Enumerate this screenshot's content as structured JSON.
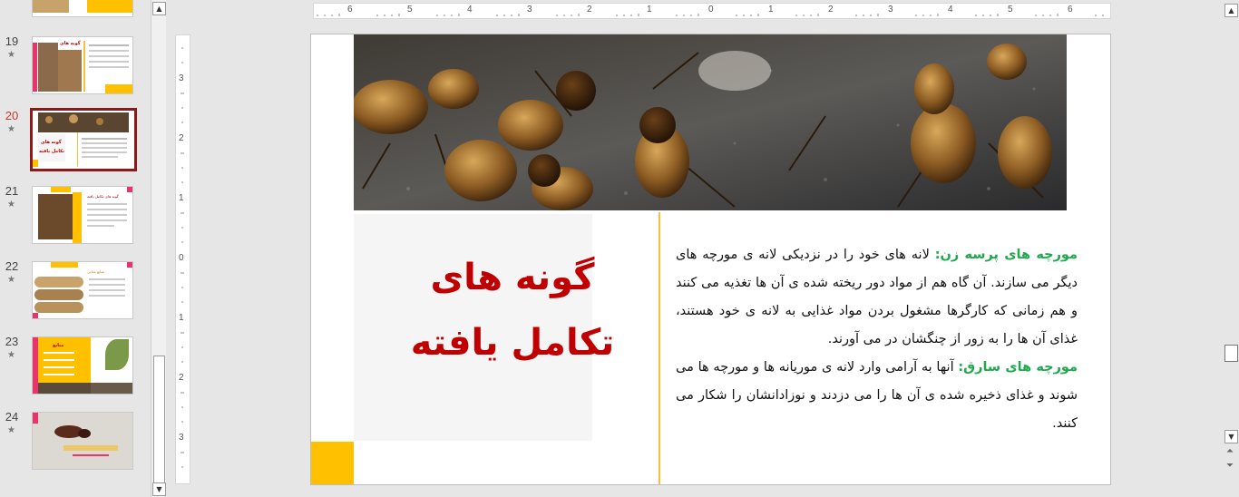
{
  "thumbnails": [
    {
      "number": "19",
      "star": "★"
    },
    {
      "number": "20",
      "star": "★"
    },
    {
      "number": "21",
      "star": "★"
    },
    {
      "number": "22",
      "star": "★"
    },
    {
      "number": "23",
      "star": "★"
    },
    {
      "number": "24",
      "star": "★"
    }
  ],
  "selected_slide": "20",
  "ruler": {
    "horizontal_ticks": [
      "6",
      "5",
      "4",
      "3",
      "2",
      "1",
      "0",
      "1",
      "2",
      "3",
      "4",
      "5",
      "6"
    ],
    "vertical_ticks": [
      "3",
      "2",
      "1",
      "0",
      "1",
      "2",
      "3"
    ]
  },
  "slide": {
    "title_line1": "گونه های",
    "title_line2": "تکامل یافته",
    "para1_label": "مورچه های پرسه زن:",
    "para1_text": " لانه های خود را در نزدیکی لانه ی مورچه های دیگر می سازند. آن گاه هم از مواد دور ریخته شده ی آن ها تغذیه می کنند و هم زمانی که کارگرها مشغول بردن مواد غذایی به لانه ی خود هستند، غذای آن ها را به زور از چنگشان در می آورند.",
    "para2_label": "مورچه های سارق:",
    "para2_text": " آنها به آرامی وارد لانه ی موریانه ها و مورچه ها می شوند و غذای ذخیره شده ی آن ها را می دزدند و نوزادانشان را شکار می کنند."
  },
  "colors": {
    "title": "#c00000",
    "label_green": "#1fa84d",
    "accent_yellow": "#ffc000",
    "selection_border": "#8b1a1a"
  },
  "icons": [
    "scroll-up-icon",
    "scroll-down-icon",
    "previous-slide-icon",
    "next-slide-icon",
    "star-icon"
  ]
}
